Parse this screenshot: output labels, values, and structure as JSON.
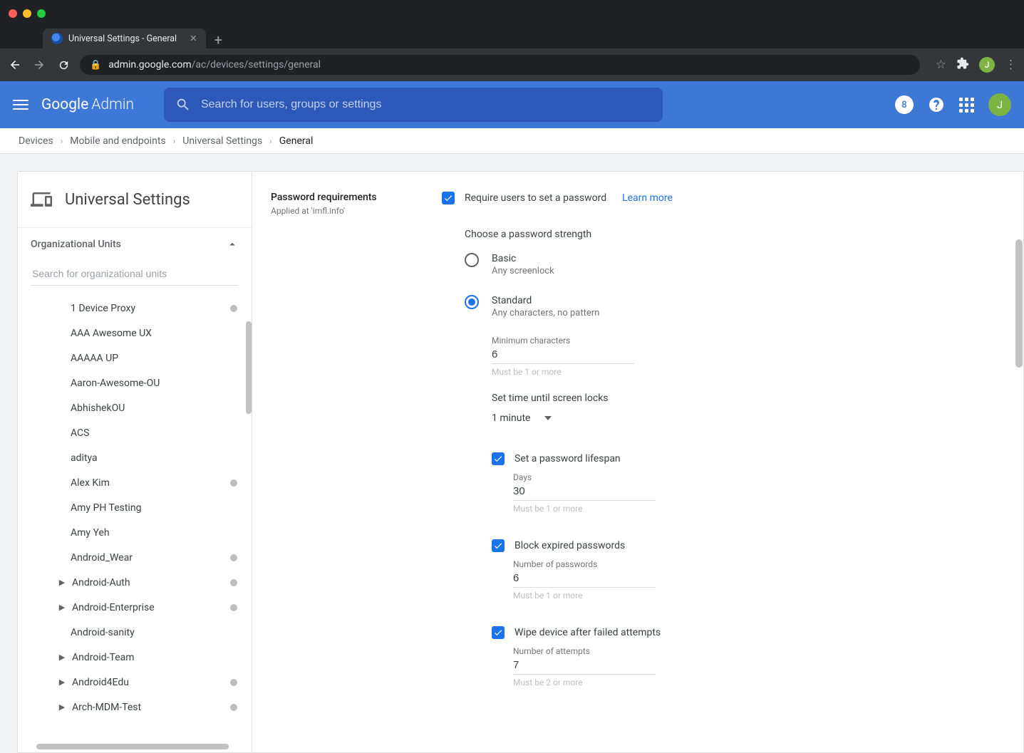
{
  "browser": {
    "tab_title": "Universal Settings - General",
    "url_host": "admin.google.com",
    "url_path": "/ac/devices/settings/general",
    "avatar_letter": "J"
  },
  "header": {
    "logo_google": "Google",
    "logo_admin": "Admin",
    "search_placeholder": "Search for users, groups or settings",
    "badge": "8",
    "avatar": "J"
  },
  "breadcrumb": {
    "items": [
      "Devices",
      "Mobile and endpoints",
      "Universal Settings"
    ],
    "current": "General"
  },
  "sidebar": {
    "title": "Universal Settings",
    "section_title": "Organizational Units",
    "search_placeholder": "Search for organizational units",
    "ous": [
      {
        "name": "1 Device Proxy",
        "dot": true
      },
      {
        "name": "AAA Awesome UX",
        "dot": false
      },
      {
        "name": "AAAAA UP",
        "dot": false
      },
      {
        "name": "Aaron-Awesome-OU",
        "dot": false
      },
      {
        "name": "AbhishekOU",
        "dot": false
      },
      {
        "name": "ACS",
        "dot": false
      },
      {
        "name": "aditya",
        "dot": false
      },
      {
        "name": "Alex Kim",
        "dot": true
      },
      {
        "name": "Amy PH Testing",
        "dot": false
      },
      {
        "name": "Amy Yeh",
        "dot": false
      },
      {
        "name": "Android_Wear",
        "dot": true
      },
      {
        "name": "Android-Auth",
        "dot": true,
        "expand": true
      },
      {
        "name": "Android-Enterprise",
        "dot": true,
        "expand": true
      },
      {
        "name": "Android-sanity",
        "dot": false
      },
      {
        "name": "Android-Team",
        "dot": false,
        "expand": true
      },
      {
        "name": "Android4Edu",
        "dot": true,
        "expand": true
      },
      {
        "name": "Arch-MDM-Test",
        "dot": true,
        "expand": true
      }
    ]
  },
  "settings": {
    "section_name": "Password requirements",
    "applied_at": "Applied at 'imfl.info'",
    "require_label": "Require users to set a password",
    "learn_more": "Learn more",
    "strength_heading": "Choose a password strength",
    "option_basic": {
      "title": "Basic",
      "sub": "Any screenlock"
    },
    "option_standard": {
      "title": "Standard",
      "sub": "Any characters, no pattern"
    },
    "min_chars": {
      "label": "Minimum characters",
      "value": "6",
      "helper": "Must be 1 or more"
    },
    "screen_lock_heading": "Set time until screen locks",
    "screen_lock_value": "1 minute",
    "lifespan": {
      "label": "Set a password lifespan",
      "field_label": "Days",
      "value": "30",
      "helper": "Must be 1 or more"
    },
    "block_expired": {
      "label": "Block expired passwords",
      "field_label": "Number of passwords",
      "value": "6",
      "helper": "Must be 1 or more"
    },
    "wipe": {
      "label": "Wipe device after failed attempts",
      "field_label": "Number of attempts",
      "value": "7",
      "helper": "Must be 2 or more"
    }
  }
}
